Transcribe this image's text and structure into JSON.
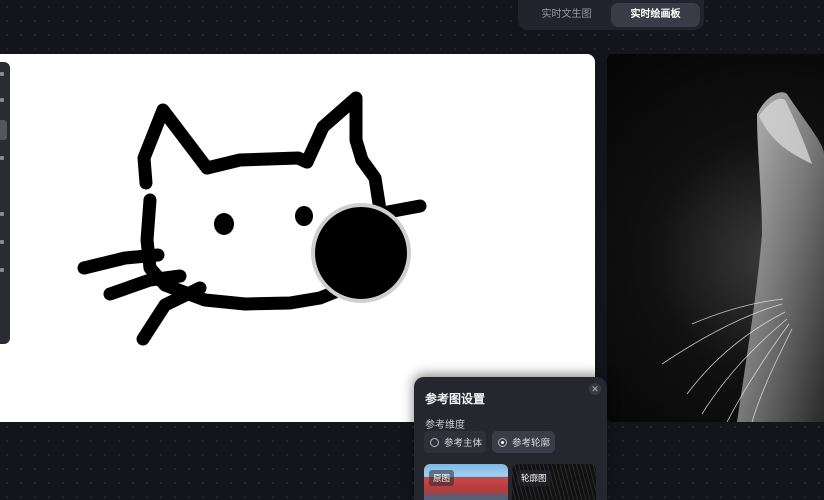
{
  "mode_tabs": [
    {
      "label": "实时文生图",
      "active": false
    },
    {
      "label": "实时绘画板",
      "active": true
    }
  ],
  "panel": {
    "title": "参考图设置",
    "close_icon": "close-icon",
    "dimension_label": "参考维度",
    "options": [
      {
        "label": "参考主体",
        "selected": false
      },
      {
        "label": "参考轮廓",
        "selected": true
      }
    ],
    "thumbnails": [
      {
        "label": "原图"
      },
      {
        "label": "轮廓图"
      }
    ]
  },
  "colors": {
    "background": "#14141c",
    "canvas": "#ffffff",
    "stroke": "#000000",
    "panel": "#26262f"
  }
}
